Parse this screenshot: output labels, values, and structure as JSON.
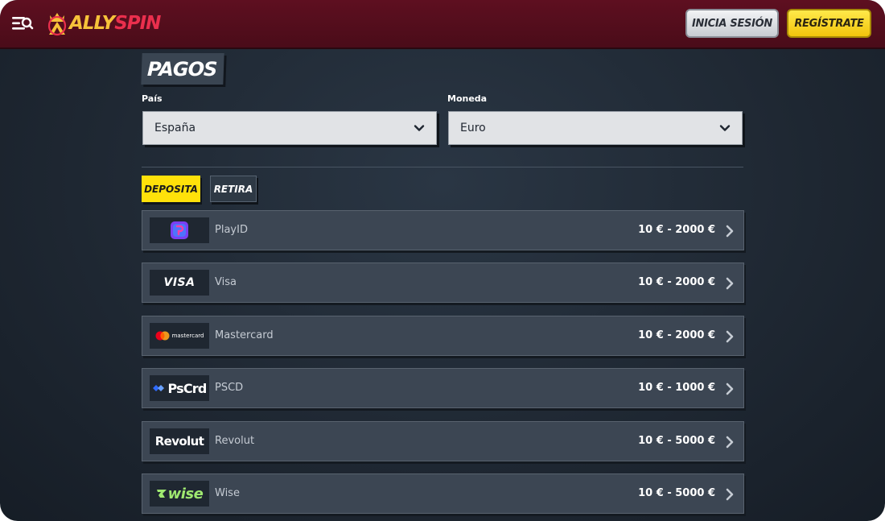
{
  "header": {
    "brand": {
      "part1": "ALLY",
      "part2": "SPIN"
    },
    "login_label": "INICIA SESIÓN",
    "register_label": "REGÍSTRATE",
    "menu_icon": "menu-search-icon"
  },
  "page": {
    "title": "PAGOS",
    "country": {
      "label": "País",
      "value": "España"
    },
    "currency": {
      "label": "Moneda",
      "value": "Euro"
    },
    "tabs": {
      "deposit": "DEPOSITA",
      "withdraw": "RETIRA",
      "active": "deposit"
    }
  },
  "methods": [
    {
      "name": "PlayID",
      "range": "10 € - 2000 €",
      "logo_icon": "playid-logo",
      "logo_text": ""
    },
    {
      "name": "Visa",
      "range": "10 € - 2000 €",
      "logo_icon": "visa-logo",
      "logo_text": "VISA"
    },
    {
      "name": "Mastercard",
      "range": "10 € - 2000 €",
      "logo_icon": "mastercard-logo",
      "logo_text": "mastercard"
    },
    {
      "name": "PSCD",
      "range": "10 € - 1000 €",
      "logo_icon": "pscd-logo",
      "logo_text": "PsCrd"
    },
    {
      "name": "Revolut",
      "range": "10 € - 5000 €",
      "logo_icon": "revolut-logo",
      "logo_text": "Revolut"
    },
    {
      "name": "Wise",
      "range": "10 € - 5000 €",
      "logo_icon": "wise-logo",
      "logo_text": "wise"
    }
  ],
  "colors": {
    "header_bg": "#4a0c19",
    "page_bg": "#1f2833",
    "deposit_tab": "#ffe10a",
    "register_button": "#f2c40c"
  }
}
